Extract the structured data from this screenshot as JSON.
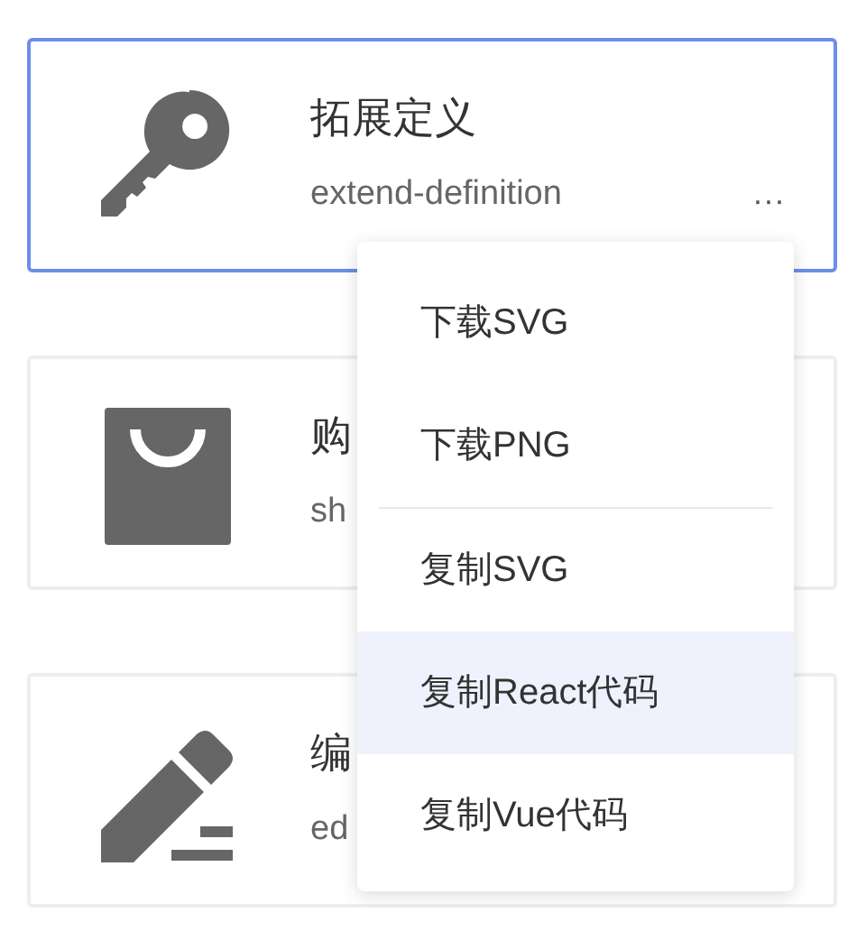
{
  "cards": [
    {
      "title": "拓展定义",
      "subtitle": "extend-definition",
      "more": "···",
      "selected": true
    },
    {
      "title": "购",
      "subtitle": "sh",
      "selected": false
    },
    {
      "title": "编",
      "subtitle": "ed",
      "selected": false
    }
  ],
  "menu": {
    "groups": [
      [
        {
          "label": "下载SVG",
          "highlighted": false
        },
        {
          "label": "下载PNG",
          "highlighted": false
        }
      ],
      [
        {
          "label": "复制SVG",
          "highlighted": false
        },
        {
          "label": "复制React代码",
          "highlighted": true
        },
        {
          "label": "复制Vue代码",
          "highlighted": false
        }
      ]
    ]
  }
}
